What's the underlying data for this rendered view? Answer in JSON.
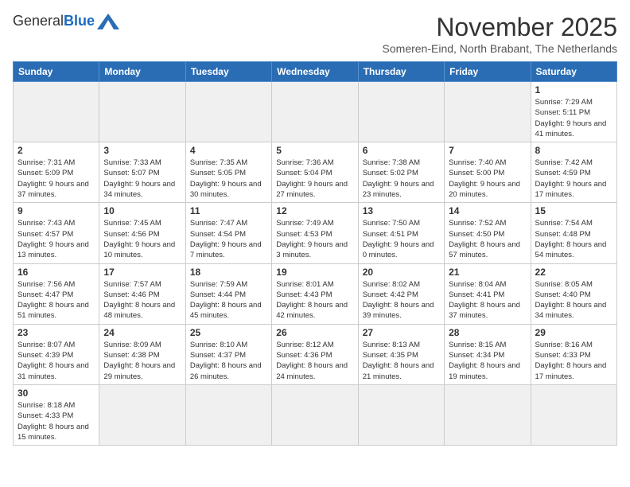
{
  "header": {
    "logo_general": "General",
    "logo_blue": "Blue",
    "month_title": "November 2025",
    "location": "Someren-Eind, North Brabant, The Netherlands"
  },
  "weekdays": [
    "Sunday",
    "Monday",
    "Tuesday",
    "Wednesday",
    "Thursday",
    "Friday",
    "Saturday"
  ],
  "days": [
    {
      "date": "",
      "empty": true
    },
    {
      "date": "",
      "empty": true
    },
    {
      "date": "",
      "empty": true
    },
    {
      "date": "",
      "empty": true
    },
    {
      "date": "",
      "empty": true
    },
    {
      "date": "",
      "empty": true
    },
    {
      "date": "1",
      "sunrise": "7:29 AM",
      "sunset": "5:11 PM",
      "daylight": "9 hours and 41 minutes."
    },
    {
      "date": "2",
      "sunrise": "7:31 AM",
      "sunset": "5:09 PM",
      "daylight": "9 hours and 37 minutes."
    },
    {
      "date": "3",
      "sunrise": "7:33 AM",
      "sunset": "5:07 PM",
      "daylight": "9 hours and 34 minutes."
    },
    {
      "date": "4",
      "sunrise": "7:35 AM",
      "sunset": "5:05 PM",
      "daylight": "9 hours and 30 minutes."
    },
    {
      "date": "5",
      "sunrise": "7:36 AM",
      "sunset": "5:04 PM",
      "daylight": "9 hours and 27 minutes."
    },
    {
      "date": "6",
      "sunrise": "7:38 AM",
      "sunset": "5:02 PM",
      "daylight": "9 hours and 23 minutes."
    },
    {
      "date": "7",
      "sunrise": "7:40 AM",
      "sunset": "5:00 PM",
      "daylight": "9 hours and 20 minutes."
    },
    {
      "date": "8",
      "sunrise": "7:42 AM",
      "sunset": "4:59 PM",
      "daylight": "9 hours and 17 minutes."
    },
    {
      "date": "9",
      "sunrise": "7:43 AM",
      "sunset": "4:57 PM",
      "daylight": "9 hours and 13 minutes."
    },
    {
      "date": "10",
      "sunrise": "7:45 AM",
      "sunset": "4:56 PM",
      "daylight": "9 hours and 10 minutes."
    },
    {
      "date": "11",
      "sunrise": "7:47 AM",
      "sunset": "4:54 PM",
      "daylight": "9 hours and 7 minutes."
    },
    {
      "date": "12",
      "sunrise": "7:49 AM",
      "sunset": "4:53 PM",
      "daylight": "9 hours and 3 minutes."
    },
    {
      "date": "13",
      "sunrise": "7:50 AM",
      "sunset": "4:51 PM",
      "daylight": "9 hours and 0 minutes."
    },
    {
      "date": "14",
      "sunrise": "7:52 AM",
      "sunset": "4:50 PM",
      "daylight": "8 hours and 57 minutes."
    },
    {
      "date": "15",
      "sunrise": "7:54 AM",
      "sunset": "4:48 PM",
      "daylight": "8 hours and 54 minutes."
    },
    {
      "date": "16",
      "sunrise": "7:56 AM",
      "sunset": "4:47 PM",
      "daylight": "8 hours and 51 minutes."
    },
    {
      "date": "17",
      "sunrise": "7:57 AM",
      "sunset": "4:46 PM",
      "daylight": "8 hours and 48 minutes."
    },
    {
      "date": "18",
      "sunrise": "7:59 AM",
      "sunset": "4:44 PM",
      "daylight": "8 hours and 45 minutes."
    },
    {
      "date": "19",
      "sunrise": "8:01 AM",
      "sunset": "4:43 PM",
      "daylight": "8 hours and 42 minutes."
    },
    {
      "date": "20",
      "sunrise": "8:02 AM",
      "sunset": "4:42 PM",
      "daylight": "8 hours and 39 minutes."
    },
    {
      "date": "21",
      "sunrise": "8:04 AM",
      "sunset": "4:41 PM",
      "daylight": "8 hours and 37 minutes."
    },
    {
      "date": "22",
      "sunrise": "8:05 AM",
      "sunset": "4:40 PM",
      "daylight": "8 hours and 34 minutes."
    },
    {
      "date": "23",
      "sunrise": "8:07 AM",
      "sunset": "4:39 PM",
      "daylight": "8 hours and 31 minutes."
    },
    {
      "date": "24",
      "sunrise": "8:09 AM",
      "sunset": "4:38 PM",
      "daylight": "8 hours and 29 minutes."
    },
    {
      "date": "25",
      "sunrise": "8:10 AM",
      "sunset": "4:37 PM",
      "daylight": "8 hours and 26 minutes."
    },
    {
      "date": "26",
      "sunrise": "8:12 AM",
      "sunset": "4:36 PM",
      "daylight": "8 hours and 24 minutes."
    },
    {
      "date": "27",
      "sunrise": "8:13 AM",
      "sunset": "4:35 PM",
      "daylight": "8 hours and 21 minutes."
    },
    {
      "date": "28",
      "sunrise": "8:15 AM",
      "sunset": "4:34 PM",
      "daylight": "8 hours and 19 minutes."
    },
    {
      "date": "29",
      "sunrise": "8:16 AM",
      "sunset": "4:33 PM",
      "daylight": "8 hours and 17 minutes."
    },
    {
      "date": "30",
      "sunrise": "8:18 AM",
      "sunset": "4:33 PM",
      "daylight": "8 hours and 15 minutes."
    },
    {
      "date": "",
      "empty": true
    },
    {
      "date": "",
      "empty": true
    },
    {
      "date": "",
      "empty": true
    },
    {
      "date": "",
      "empty": true
    },
    {
      "date": "",
      "empty": true
    },
    {
      "date": "",
      "empty": true
    }
  ],
  "labels": {
    "sunrise": "Sunrise:",
    "sunset": "Sunset:",
    "daylight": "Daylight:"
  }
}
